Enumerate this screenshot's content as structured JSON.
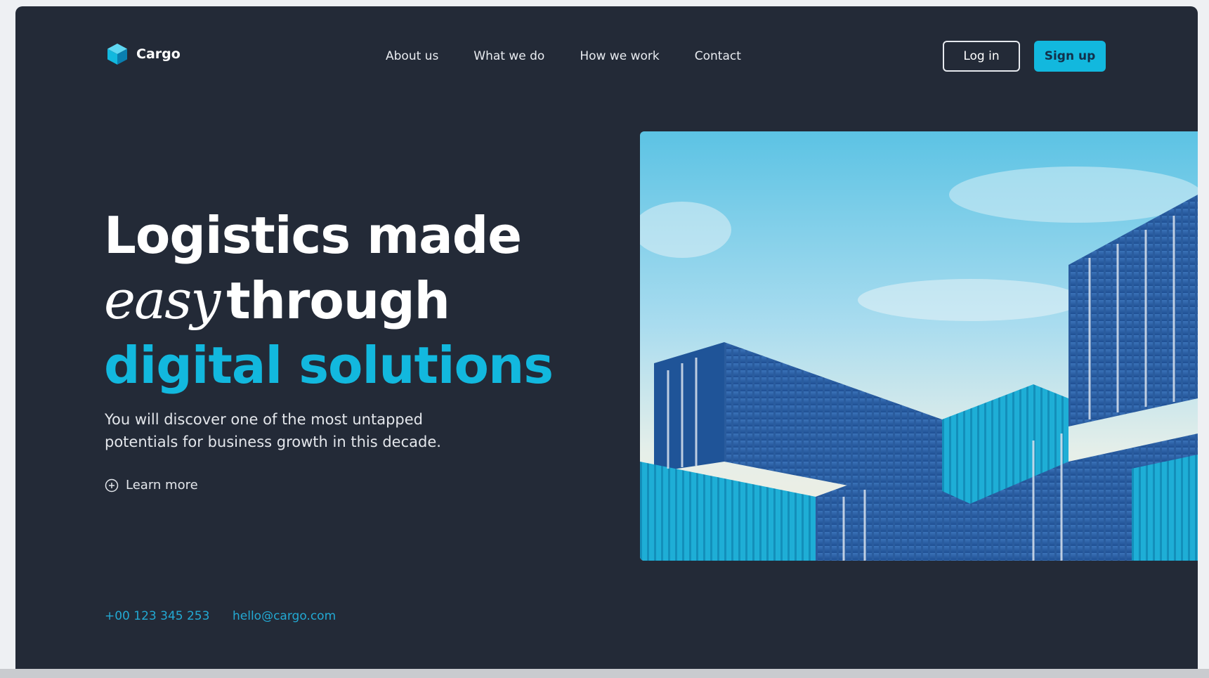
{
  "brand": {
    "name": "Cargo",
    "logo_icon": "cube-icon",
    "accent_color": "#12b8de",
    "background_color": "#232a37"
  },
  "nav": {
    "items": [
      "About us",
      "What we do",
      "How we work",
      "Contact"
    ]
  },
  "auth": {
    "login_label": "Log in",
    "signup_label": "Sign up"
  },
  "hero": {
    "headline_line1": "Logistics made",
    "headline_easy": "easy",
    "headline_through": "through",
    "headline_accent": "digital solutions",
    "subtext": "You will discover one of the most untapped potentials for business growth in this decade.",
    "learn_more_label": "Learn more",
    "learn_more_icon": "plus-circle-icon",
    "image_subject": "stacked blue shipping containers against a sky"
  },
  "contact": {
    "phone": "+00 123 345 253",
    "email": "hello@cargo.com"
  }
}
